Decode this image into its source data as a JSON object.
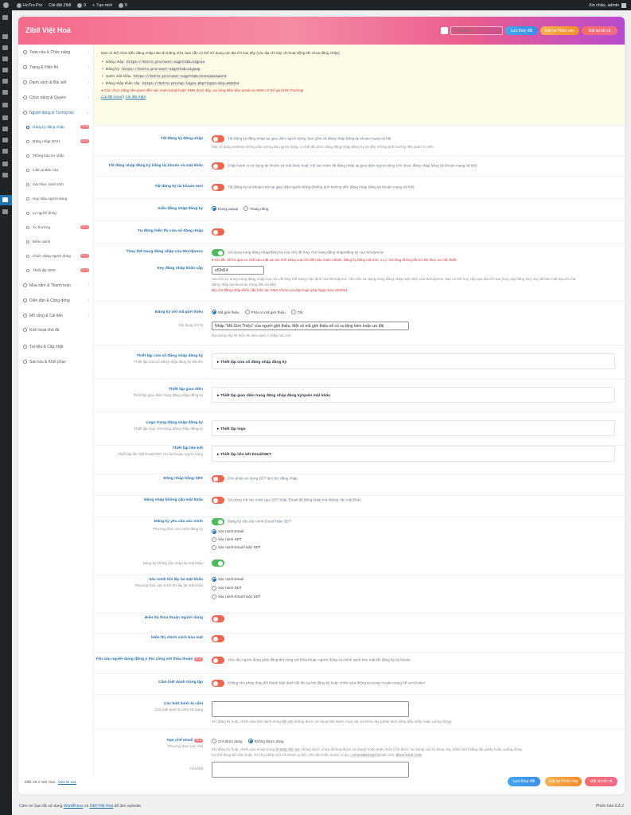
{
  "adminbar": {
    "site": "HoTro.Pro",
    "customize": "Cài đặt Zibll",
    "comments": "0",
    "new": "Tạo mới",
    "zero": "0",
    "greeting": "Xin chào, admin"
  },
  "header": {
    "title": "Zibll Việt Hoá",
    "search_placeholder": "Tìm kiếm...",
    "save": "Lưu thay đổi",
    "reset_section": "Đặt lại Phần này",
    "reset_all": "Đặt lại tất cả"
  },
  "sidebar": {
    "items": [
      {
        "label": "Toàn cầu & Chức năng"
      },
      {
        "label": "Trang & Hiển thị"
      },
      {
        "label": "Danh sách & Bài viết"
      },
      {
        "label": "Chức năng & Quyền"
      },
      {
        "label": "Người dùng & Tương tác"
      }
    ],
    "subitems": [
      {
        "label": "Đăng ký đăng nhập",
        "badge": "V7.5"
      },
      {
        "label": "Đăng nhập MXH",
        "badge": "V7.2"
      },
      {
        "label": "Thông báo tin nhắn",
        "badge": ""
      },
      {
        "label": "Cấm & Báo cáo",
        "badge": ""
      },
      {
        "label": "Xác thực danh tính",
        "badge": ""
      },
      {
        "label": "Huy hiệu người dùng",
        "badge": ""
      },
      {
        "label": "Lv người dùng",
        "badge": ""
      },
      {
        "label": "Xu thưởng",
        "badge": "V7.4"
      },
      {
        "label": "Điểm danh",
        "badge": ""
      },
      {
        "label": "Chức năng người dùng",
        "badge": "V7.3"
      },
      {
        "label": "Thiết lập SMS",
        "badge": "V7.5"
      }
    ],
    "items2": [
      {
        "label": "Mua sắm & Thanh toán"
      },
      {
        "label": "Diễn đàn & Cộng đồng"
      },
      {
        "label": "Mở rộng & Cải tiến"
      },
      {
        "label": "Kích hoạt chủ đề"
      },
      {
        "label": "Tài liệu & Cập nhật"
      },
      {
        "label": "Sao lưu & Khôi phục"
      }
    ]
  },
  "notice": {
    "intro": "Bạn có thể chọn kiểu đăng nhập nào đi chăng nữa, bạn vẫn có thể sử dụng các địa chỉ sau đây (các địa chỉ này chỉ hoạt động khi chưa đăng nhập):",
    "links": [
      {
        "label": "Đăng nhập:",
        "code": "https://hotro.pro/user-sign?tab=signin"
      },
      {
        "label": "Đăng ký:",
        "code": "https://hotro.pro/user-sign?tab=signup"
      },
      {
        "label": "Quên mật khẩu:",
        "code": "https://hotro.pro/user-sign?tab=resetpassword"
      },
      {
        "label": "Đăng nhập khẩn cấp:",
        "code": "https://hotro.pro/wp-login.php?login-key=e53d14"
      }
    ],
    "warning": "Các chức năng liên quan đến xác minh email hoặc SMS dưới đây, vui lòng đảm bảo email và SMS có thể gửi bình thường!",
    "link1": "Cài đặt email",
    "sep": " | ",
    "link2": "Cài đặt SMS"
  },
  "rows": {
    "r1": {
      "label": "Tắt đăng ký đăng nhập",
      "desc": "Tắt đăng ký đăng nhập tại giao diện người dùng, bao gồm cả đăng nhập bằng tài khoản mạng xã hội",
      "desc2": "Một số dạng website không cần tương tác người dùng, có thể tắt chức năng đăng nhập đăng ký tại đây, không ảnh hưởng đến quản trị viên."
    },
    "r2": {
      "label": "Tắt đăng nhập đăng ký bằng tài khoản và mật khẩu",
      "desc": "Chặn hành vi sử dụng tài khoản và mật khẩu hoặc mã xác minh để đăng nhập tại giao diện người dùng (chỉ được đăng nhập bằng tài khoản mạng xã hội)"
    },
    "r3": {
      "label": "Tắt đăng ký tài khoản mới",
      "desc": "Tắt đăng ký tài khoản mới tại giao diện người dùng (không ảnh hưởng đến đăng nhập bằng tài khoản mạng xã hội)"
    },
    "r4": {
      "label": "Kiểu đăng nhập đăng ký",
      "o1": "Dạng popup",
      "o2": "Trang riêng"
    },
    "r5": {
      "label": "Tự động hiển thị cửa sổ đăng nhập"
    },
    "r6": {
      "label": "Thay thế trang đăng nhập của Wordpress",
      "desc": "Sử dụng trang đăng nhập/đăng ký của chủ đề thay cho trang đăng nhập/đăng ký của Wordpress",
      "warn": "Khi tắt, sẽ bỏ qua cơ chế bảo mật và các tính năng của chủ đề (xác minh robots, đăng ký bằng mã mời, v.v.). Vui lòng không tắt trừ khi thực sự cần thiết."
    },
    "r7": {
      "label": "Key đăng nhập khẩn cấp",
      "value": "e53d14",
      "d1": "Sau khi sử dụng trang đăng nhập của chủ đề thay thế trang mặc định của Wordpress, nếu cần sử dụng trang đăng nhập mặc định của Wordpress, bạn có thể truy cập qua địa chỉ sau (truy cập bằng Key này để bảo mật địa chỉ của",
      "d2": "đăng nhập backend do trang đặt cài đặt)",
      "d3": "Địa chỉ đăng nhập khẩn cấp hiện tại: https://hotro.pro/wp-login.php?login-key=e53d14"
    },
    "r8": {
      "label": "Đăng ký với mã giới thiệu",
      "o1": "Mã giới thiệu",
      "o2": "Phải có mã giới thiệu",
      "o3": "Tắt",
      "sublabel": "Nội dung mô tả",
      "value": "Nhập \"Mã Giới Thiệu\" của người giới thiệu. Một số mã giới thiệu sẽ có xu tặng kèm hoặc ưu đãi",
      "desc": "Nội dung này sẽ hiển thị bên cạnh ô nhập mã mời"
    },
    "r9": {
      "label": "Thiết lập cửa sổ đăng nhập đăng ký",
      "sub": "Thiết lập cửa sổ đăng nhập đăng ký bật lên",
      "acc": "Thiết lập cửa sổ đăng nhập đăng ký"
    },
    "r10": {
      "label": "Thiết lập giao diện",
      "sub": "Thiết lập giao diện trang đăng nhập đăng ký",
      "acc": "Thiết lập giao diện trang đăng nhập đăng ký/quên mật khẩu"
    },
    "r11": {
      "label": "Logo trang đăng nhập đăng ký",
      "sub": "Thiết lập logo cho trang đăng nhập đăng ký",
      "acc": "Thiết lập logo"
    },
    "r12": {
      "label": "Thiết lập liên kết",
      "sub": "Thiết lập liên kết Email/SĐT với tài khoản người dùng",
      "acc": "Thiết lập liên kết Email/SĐT"
    },
    "r13": {
      "label": "Đăng nhập bằng SĐT",
      "desc": "Cho phép sử dụng SĐT làm tên đăng nhập"
    },
    "r14": {
      "label": "Đăng nhập không cần mật khẩu",
      "desc": "Sử dụng mã xác minh qua SĐT hoặc Email để đăng nhập mà không cần mật khẩu"
    },
    "r15": {
      "label": "Đăng ký yêu cầu xác minh",
      "sub": "Phương thức xác minh đăng ký",
      "desc": "Đăng ký cần xác minh Email hoặc SĐT",
      "o1": "Xác minh Email",
      "o2": "Xác minh SĐT",
      "o3": "Xác minh Email hoặc SĐT",
      "sub2": "Đăng ký không cần nhập lại mật khẩu"
    },
    "r16": {
      "label": "Xác minh khi lấy lại mật khẩu",
      "sub": "Phương thức xác minh khi lấy lại mật khẩu",
      "o1": "Xác minh Email",
      "o2": "Xác minh SĐT",
      "o3": "Xác minh Email hoặc SĐT"
    },
    "r17": {
      "label": "Hiển thị thỏa thuận người dùng"
    },
    "r18": {
      "label": "Hiển thị chính sách bảo mật"
    },
    "r19": {
      "label": "Yêu cầu người dùng đồng ý thủ công với thỏa thuận",
      "badge": "V7.2",
      "desc": "Yêu cầu người dùng phải đồng thủ công với thỏa thuận người dùng và chính sách bảo mật khi đăng ký tài khoản"
    },
    "r20": {
      "label": "Cấm biệt danh trùng lặp",
      "desc": "Không cho phép thay đổi thành biệt danh đã tồn tại khi đăng ký hoặc chỉnh sửa thông tin trong <code>trang hồ sơ</code>"
    },
    "r21": {
      "label": "Các biệt danh bị cấm",
      "sub": "Các biệt danh bị cấm sử dụng",
      "d1": "Khi đăng ký hoặc chỉnh sửa biệt danh trong",
      "code": "hồ sơ",
      "d2": ", không được sử dụng biệt danh chứa các từ khóa này (phân tách bằng dấu phẩy hoặc xuống dòng)"
    },
    "r22": {
      "label": "Hạn chế email",
      "badge": "V7.4",
      "sub": "Phương thức hạn chế",
      "o1": "Chỉ được dùng",
      "o2": "Không được dùng",
      "d1": "Khi đăng ký hoặc chỉnh sửa email trong",
      "code": "trang hồ sơ",
      "d2": ", không được chứa (không được sử dụng) hoặc phải chứa (Chỉ được sử dụng) các từ khóa này, phân tách bằng dấu phẩy hoặc xuống dòng.",
      "d3": "Có thể dùng để cấm hoặc chỉ cho phép một số email cụ thể, như tên miền email, ví dụ:",
      "c1": "_asscmbblog",
      "d4": "@gmail.com,",
      "c2": "@outlook.com",
      "sub2": "Từ khóa"
    }
  },
  "footer": {
    "left": "Zibll V8.1 Việt Hoá - ",
    "link": "Mèo Bị Lạc",
    "thanks": "Cảm ơn bạn đã sử dụng ",
    "wp": "WordPress",
    "and": " và ",
    "zv": "Zibll Việt Hoá",
    "tail": " để làm website.",
    "version": "Phiên bản 6.8.2"
  },
  "colors": {
    "accent": "#2271b1",
    "toggle_off": "#f0654f",
    "toggle_on": "#4cba5a"
  }
}
